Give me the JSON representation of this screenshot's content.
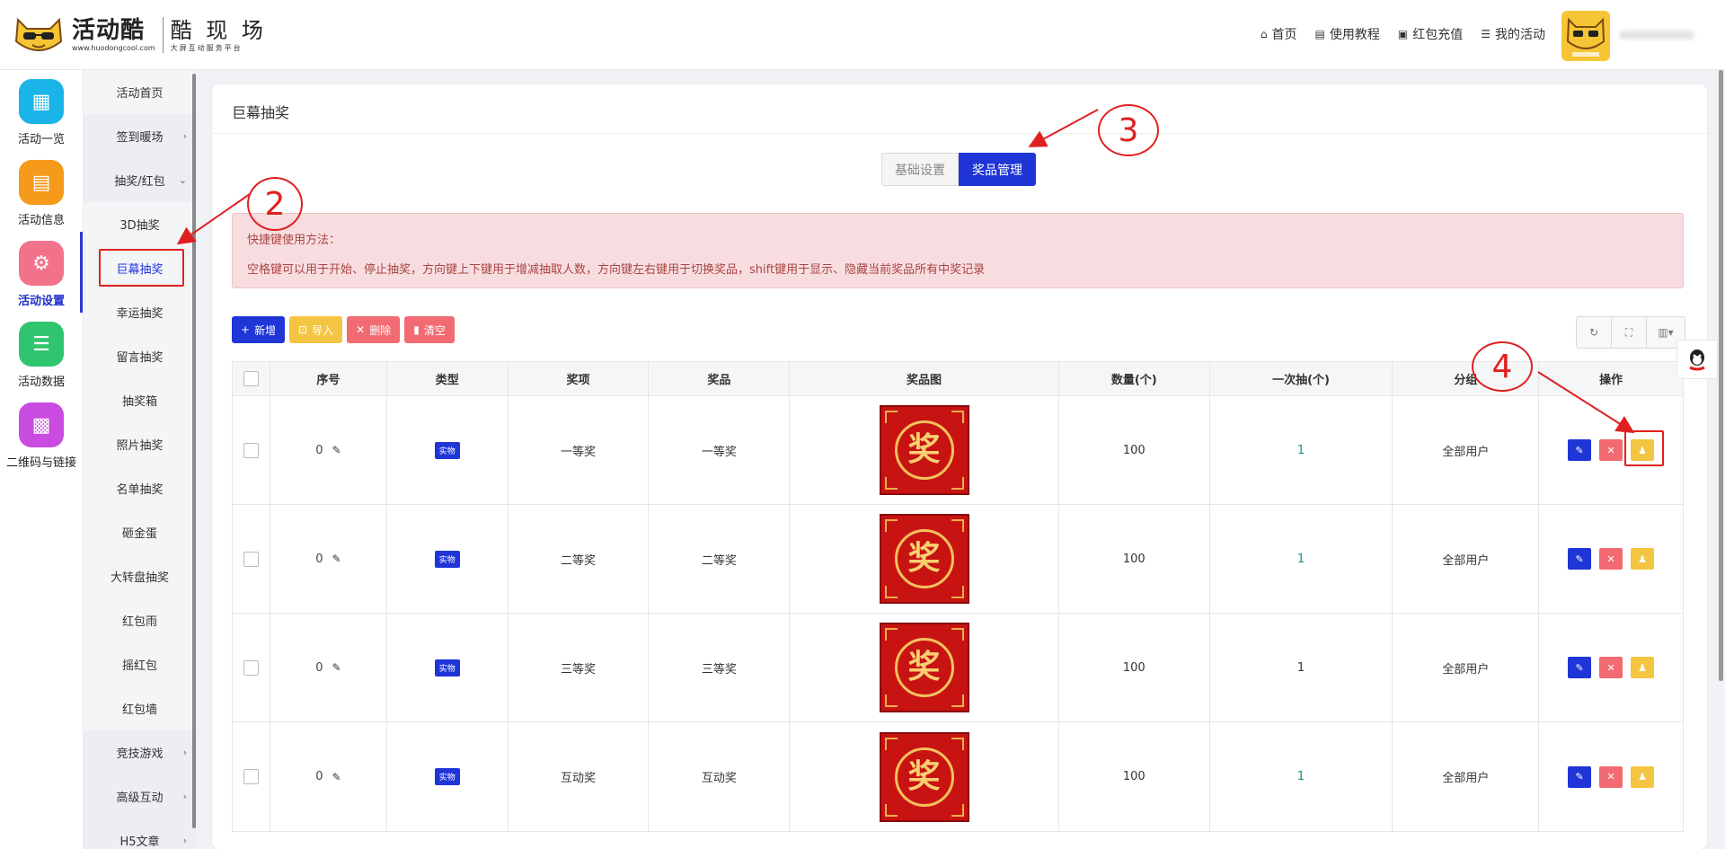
{
  "header": {
    "logo": {
      "brand": "活动酷",
      "url": "www.huodongcool.com",
      "sub_title": "酷 现 场",
      "sub_desc": "大屏互动服务平台"
    },
    "nav": [
      {
        "icon": "⌂",
        "icon_name": "home-icon",
        "label": "首页"
      },
      {
        "icon": "▤",
        "icon_name": "book-icon",
        "label": "使用教程"
      },
      {
        "icon": "▣",
        "icon_name": "redpacket-icon",
        "label": "红包充值"
      },
      {
        "icon": "☰",
        "icon_name": "list-icon",
        "label": "我的活动"
      }
    ]
  },
  "icon_sidebar": [
    {
      "label": "活动一览",
      "color": "#1ab4e8",
      "icon": "▦",
      "icon_name": "grid-icon"
    },
    {
      "label": "活动信息",
      "color": "#f59a1a",
      "icon": "▤",
      "icon_name": "document-icon"
    },
    {
      "label": "活动设置",
      "color": "#f2728c",
      "icon": "⚙",
      "icon_name": "gear-icon",
      "active": true
    },
    {
      "label": "活动数据",
      "color": "#2fc56f",
      "icon": "☰",
      "icon_name": "database-icon"
    },
    {
      "label": "二维码与链接",
      "color": "#c94be0",
      "icon": "▩",
      "icon_name": "qrcode-icon"
    }
  ],
  "sub_menu": [
    {
      "label": "活动首页"
    },
    {
      "label": "签到暖场",
      "chevron": "›"
    },
    {
      "label": "抽奖/红包",
      "chevron": "⌄",
      "parent": true
    },
    {
      "label": "3D抽奖"
    },
    {
      "label": "巨幕抽奖",
      "active": true
    },
    {
      "label": "幸运抽奖"
    },
    {
      "label": "留言抽奖"
    },
    {
      "label": "抽奖箱"
    },
    {
      "label": "照片抽奖"
    },
    {
      "label": "名单抽奖"
    },
    {
      "label": "砸金蛋"
    },
    {
      "label": "大转盘抽奖"
    },
    {
      "label": "红包雨"
    },
    {
      "label": "摇红包"
    },
    {
      "label": "红包墙"
    },
    {
      "label": "竞技游戏",
      "chevron": "›"
    },
    {
      "label": "高级互动",
      "chevron": "›"
    },
    {
      "label": "H5文章",
      "chevron": "›"
    }
  ],
  "panel": {
    "title": "巨幕抽奖",
    "tabs": {
      "basic": "基础设置",
      "prizes": "奖品管理"
    },
    "alert": {
      "line1": "快捷键使用方法：",
      "line2": "空格键可以用于开始、停止抽奖，方向键上下键用于增减抽取人数，方向键左右键用于切换奖品，shift键用于显示、隐藏当前奖品所有中奖记录"
    },
    "toolbar": {
      "add": "新增",
      "add_icon": "+",
      "import": "导入",
      "import_icon": "⊡",
      "delete": "删除",
      "delete_icon": "✕",
      "clear": "清空",
      "clear_icon": "▮"
    },
    "view_tools": {
      "refresh": "↻",
      "fullscreen": "⛶",
      "columns": "▥▾"
    }
  },
  "table": {
    "headers": [
      "序号",
      "类型",
      "奖项",
      "奖品",
      "奖品图",
      "数量(个)",
      "一次抽(个)",
      "分组",
      "操作"
    ],
    "rows": [
      {
        "seq": "0",
        "type": "实物",
        "award": "一等奖",
        "prize": "一等奖",
        "qty": "100",
        "per_draw": "1",
        "group": "全部用户"
      },
      {
        "seq": "0",
        "type": "实物",
        "award": "二等奖",
        "prize": "二等奖",
        "qty": "100",
        "per_draw": "1",
        "group": "全部用户"
      },
      {
        "seq": "0",
        "type": "实物",
        "award": "三等奖",
        "prize": "三等奖",
        "qty": "100",
        "per_draw": "1",
        "group": "全部用户"
      },
      {
        "seq": "0",
        "type": "实物",
        "award": "互动奖",
        "prize": "互动奖",
        "qty": "100",
        "per_draw": "1",
        "group": "全部用户"
      }
    ],
    "prize_glyph": "奖",
    "ops": {
      "edit": "✎",
      "delete": "✕",
      "winners": "♟"
    }
  },
  "annotations": [
    "2",
    "3",
    "4"
  ],
  "colors": {
    "primary": "#1f35d6",
    "danger": "#f26b72",
    "warning": "#f4c542",
    "annotation": "#e02020"
  }
}
